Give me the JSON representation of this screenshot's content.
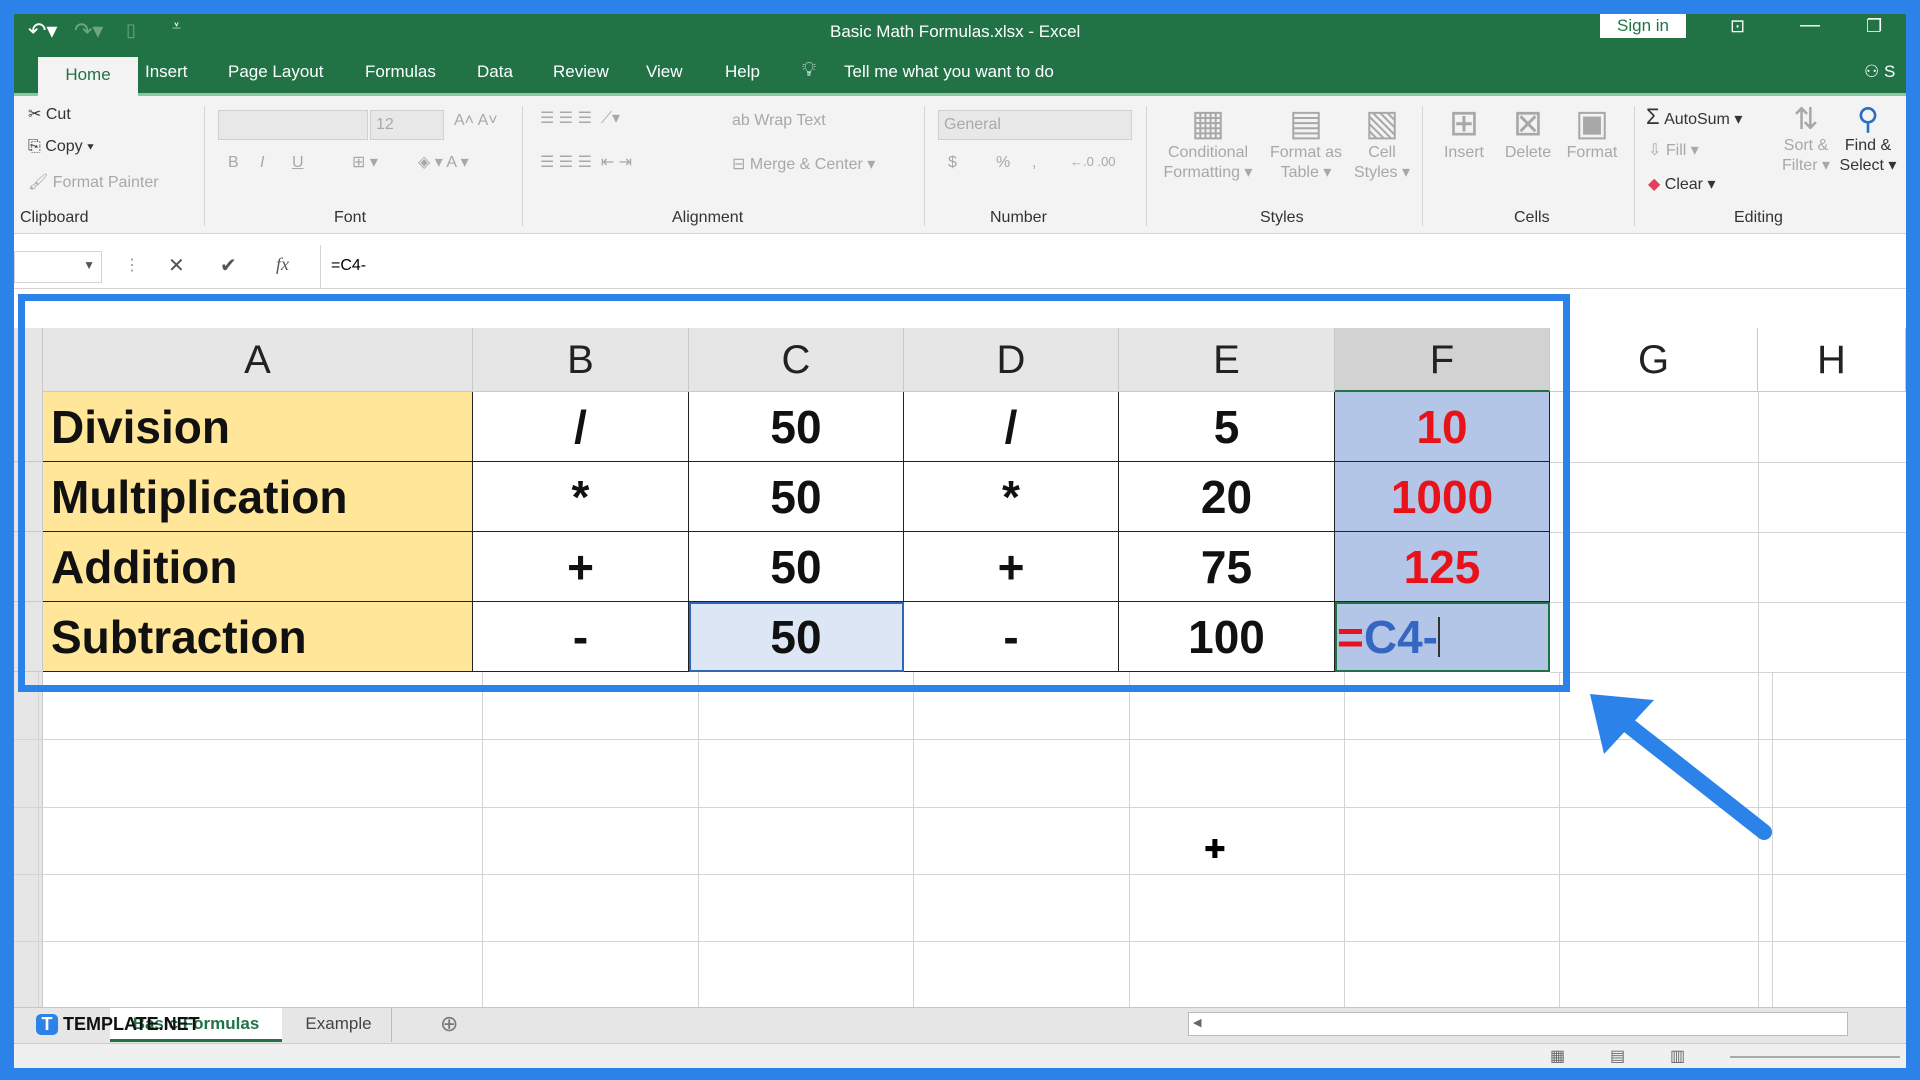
{
  "title": "Basic Math Formulas.xlsx  -  Excel",
  "sign_in": "Sign in",
  "tabs": [
    "Home",
    "Insert",
    "Page Layout",
    "Formulas",
    "Data",
    "Review",
    "View",
    "Help"
  ],
  "tell_me": "Tell me what you want to do",
  "share": "S",
  "ribbon": {
    "clipboard": {
      "cut": "Cut",
      "copy": "Copy",
      "format_painter": "Format Painter",
      "label": "Clipboard"
    },
    "font": {
      "size": "12",
      "label": "Font",
      "bold": "B",
      "italic": "I",
      "underline": "U"
    },
    "alignment": {
      "wrap": "Wrap Text",
      "merge": "Merge & Center",
      "label": "Alignment"
    },
    "number": {
      "format": "General",
      "label": "Number",
      "currency": "$",
      "percent": "%",
      "comma": ","
    },
    "styles": {
      "cond": "Conditional",
      "cond2": "Formatting",
      "fat": "Format as",
      "fat2": "Table",
      "cell": "Cell",
      "cell2": "Styles",
      "label": "Styles"
    },
    "cells": {
      "insert": "Insert",
      "delete": "Delete",
      "format": "Format",
      "label": "Cells"
    },
    "editing": {
      "autosum": "AutoSum",
      "fill": "Fill",
      "clear": "Clear",
      "sort": "Sort &",
      "sort2": "Filter",
      "find": "Find &",
      "find2": "Select",
      "label": "Editing"
    }
  },
  "formula_bar": {
    "name_box": "",
    "formula": "=C4-",
    "fx": "fx"
  },
  "columns": [
    "A",
    "B",
    "C",
    "D",
    "E",
    "F",
    "G",
    "H"
  ],
  "rows": [
    {
      "a": "Division",
      "b": "/",
      "c": "50",
      "d": "/",
      "e": "5",
      "f": "10"
    },
    {
      "a": "Multiplication",
      "b": "*",
      "c": "50",
      "d": "*",
      "e": "20",
      "f": "1000"
    },
    {
      "a": "Addition",
      "b": "+",
      "c": "50",
      "d": "+",
      "e": "75",
      "f": "125"
    },
    {
      "a": "Subtraction",
      "b": "-",
      "c": "50",
      "d": "-",
      "e": "100",
      "f_eq": "=",
      "f_ref": "C4-"
    }
  ],
  "sheets": [
    "Basic Formulas",
    "Example"
  ],
  "watermark": "TEMPLATE.NET",
  "colors": {
    "excel_green": "#217346",
    "frame_blue": "#2b82e8",
    "label_fill": "#ffe699",
    "result_fill": "#b4c6e7",
    "result_text": "#e8121b"
  }
}
